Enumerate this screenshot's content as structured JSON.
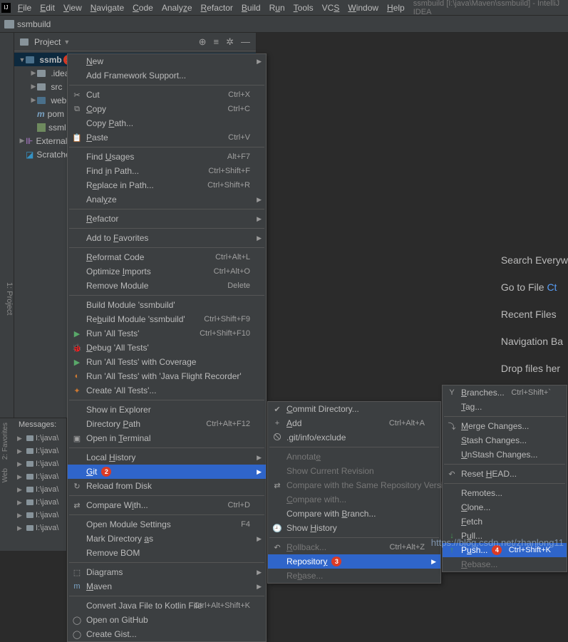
{
  "app": {
    "title_path": "ssmbuild [I:\\java\\Maven\\ssmbuild] - IntelliJ IDEA",
    "project_name": "ssmbuild"
  },
  "menubar": [
    "File",
    "Edit",
    "View",
    "Navigate",
    "Code",
    "Analyze",
    "Refactor",
    "Build",
    "Run",
    "Tools",
    "VCS",
    "Window",
    "Help"
  ],
  "pp": {
    "title": "Project"
  },
  "tree": {
    "ssmbuild": "ssmb",
    "idea": ".idea",
    "src": "src",
    "web": "web",
    "pom": "pom",
    "iml": "ssml",
    "external": "External",
    "scratches": "Scratche"
  },
  "tips": {
    "l1": "Search Everyw",
    "l2a": "Go to File ",
    "l2b": "Ct",
    "l3": "Recent Files",
    "l4": "Navigation Ba",
    "l5": "Drop files her"
  },
  "messages": {
    "header": "Messages:",
    "rows": [
      "I:\\java\\",
      "I:\\java\\",
      "I:\\java\\",
      "I:\\java\\",
      "I:\\java\\",
      "I:\\java\\",
      "I:\\java\\",
      "I:\\java\\"
    ]
  },
  "ctx1": [
    {
      "label": "New",
      "sub": true,
      "u": 0
    },
    {
      "label": "Add Framework Support..."
    },
    {
      "sep": true
    },
    {
      "label": "Cut",
      "icn": "✂",
      "sc": "Ctrl+X"
    },
    {
      "label": "Copy",
      "icn": "⧉",
      "sc": "Ctrl+C",
      "u": 0
    },
    {
      "label": "Copy Path...",
      "u": 5
    },
    {
      "label": "Paste",
      "icn": "📋",
      "sc": "Ctrl+V",
      "u": 0
    },
    {
      "sep": true
    },
    {
      "label": "Find Usages",
      "sc": "Alt+F7",
      "u": 5
    },
    {
      "label": "Find in Path...",
      "sc": "Ctrl+Shift+F",
      "u": 5
    },
    {
      "label": "Replace in Path...",
      "sc": "Ctrl+Shift+R",
      "u": 1
    },
    {
      "label": "Analyze",
      "sub": true,
      "u": 4
    },
    {
      "sep": true
    },
    {
      "label": "Refactor",
      "sub": true,
      "u": 0
    },
    {
      "sep": true
    },
    {
      "label": "Add to Favorites",
      "sub": true,
      "u": 7
    },
    {
      "sep": true
    },
    {
      "label": "Reformat Code",
      "sc": "Ctrl+Alt+L",
      "u": 0
    },
    {
      "label": "Optimize Imports",
      "sc": "Ctrl+Alt+O",
      "u": 9
    },
    {
      "label": "Remove Module",
      "sc": "Delete"
    },
    {
      "sep": true
    },
    {
      "label": "Build Module 'ssmbuild'"
    },
    {
      "label": "Rebuild Module 'ssmbuild'",
      "sc": "Ctrl+Shift+F9",
      "u": 2
    },
    {
      "label": "Run 'All Tests'",
      "icn": "▶",
      "sc": "Ctrl+Shift+F10",
      "icnc": "#59a869"
    },
    {
      "label": "Debug 'All Tests'",
      "icn": "🐞",
      "u": 0,
      "icnc": "#499c54"
    },
    {
      "label": "Run 'All Tests' with Coverage",
      "icn": "▶",
      "icnc": "#59a869"
    },
    {
      "label": "Run 'All Tests' with 'Java Flight Recorder'",
      "icn": "◐",
      "icnc": "#cc7832"
    },
    {
      "label": "Create 'All Tests'...",
      "icn": "✦",
      "icnc": "#cc7832"
    },
    {
      "sep": true
    },
    {
      "label": "Show in Explorer"
    },
    {
      "label": "Directory Path",
      "sc": "Ctrl+Alt+F12",
      "u": 10
    },
    {
      "label": "Open in Terminal",
      "icn": "▣",
      "u": 8
    },
    {
      "sep": true
    },
    {
      "label": "Local History",
      "sub": true,
      "u": 6
    },
    {
      "label": "Git",
      "sub": true,
      "u": 0,
      "sel": true,
      "badge": "2"
    },
    {
      "label": "Reload from Disk",
      "icn": "↻"
    },
    {
      "sep": true
    },
    {
      "label": "Compare With...",
      "icn": "⇄",
      "sc": "Ctrl+D",
      "u": 9
    },
    {
      "sep": true
    },
    {
      "label": "Open Module Settings",
      "sc": "F4"
    },
    {
      "label": "Mark Directory as",
      "sub": true,
      "u": 15
    },
    {
      "label": "Remove BOM"
    },
    {
      "sep": true
    },
    {
      "label": "Diagrams",
      "icn": "⬚",
      "sub": true,
      "u": 3
    },
    {
      "label": "Maven",
      "icn": "m",
      "sub": true,
      "u": 0,
      "icnc": "#7aa3c4"
    },
    {
      "sep": true
    },
    {
      "label": "Convert Java File to Kotlin File",
      "sc": "Ctrl+Alt+Shift+K"
    },
    {
      "label": "Open on GitHub",
      "icn": "◯"
    },
    {
      "label": "Create Gist...",
      "icn": "◯"
    }
  ],
  "ctx2": [
    {
      "label": "Commit Directory...",
      "icn": "✔",
      "u": 0
    },
    {
      "label": "Add",
      "icn": "+",
      "sc": "Ctrl+Alt+A",
      "u": 0
    },
    {
      "label": ".git/info/exclude",
      "icn": "🛇"
    },
    {
      "sep": true
    },
    {
      "label": "Annotate",
      "dis": true,
      "u": 7
    },
    {
      "label": "Show Current Revision",
      "dis": true
    },
    {
      "label": "Compare with the Same Repository Version",
      "dis": true,
      "icn": "⇄"
    },
    {
      "label": "Compare with...",
      "dis": true,
      "u": 0
    },
    {
      "label": "Compare with Branch...",
      "u": 13
    },
    {
      "label": "Show History",
      "icn": "🕘",
      "u": 5
    },
    {
      "sep": true
    },
    {
      "label": "Rollback...",
      "dis": true,
      "sc": "Ctrl+Alt+Z",
      "icn": "↶",
      "u": 0
    },
    {
      "label": "Repository",
      "sel": true,
      "sub": true,
      "u": 9,
      "badge": "3"
    },
    {
      "label": "Rebase...",
      "dis": true,
      "u": 2
    }
  ],
  "ctx3": [
    {
      "label": "Branches...",
      "icn": "Y",
      "sc": "Ctrl+Shift+`",
      "u": 0
    },
    {
      "label": "Tag...",
      "u": 0
    },
    {
      "sep": true
    },
    {
      "label": "Merge Changes...",
      "icn": "⤵",
      "u": 0
    },
    {
      "label": "Stash Changes...",
      "u": 0
    },
    {
      "label": "UnStash Changes...",
      "u": 0
    },
    {
      "sep": true
    },
    {
      "label": "Reset HEAD...",
      "icn": "↶",
      "u": 6
    },
    {
      "sep": true
    },
    {
      "label": "Remotes..."
    },
    {
      "label": "Clone...",
      "u": 0
    },
    {
      "label": "Fetch",
      "u": 0
    },
    {
      "label": "Pull...",
      "icn": "↓",
      "u": 1,
      "icnc": "#499c54"
    },
    {
      "label": "Push...",
      "icn": "↑",
      "sc": "Ctrl+Shift+K",
      "u": 1,
      "sel": true,
      "icnc": "#499c54",
      "badge": "4"
    },
    {
      "label": "Rebase...",
      "dis": true,
      "u": 0
    }
  ],
  "watermark": "https://blog.csdn.net/zhanlong11"
}
